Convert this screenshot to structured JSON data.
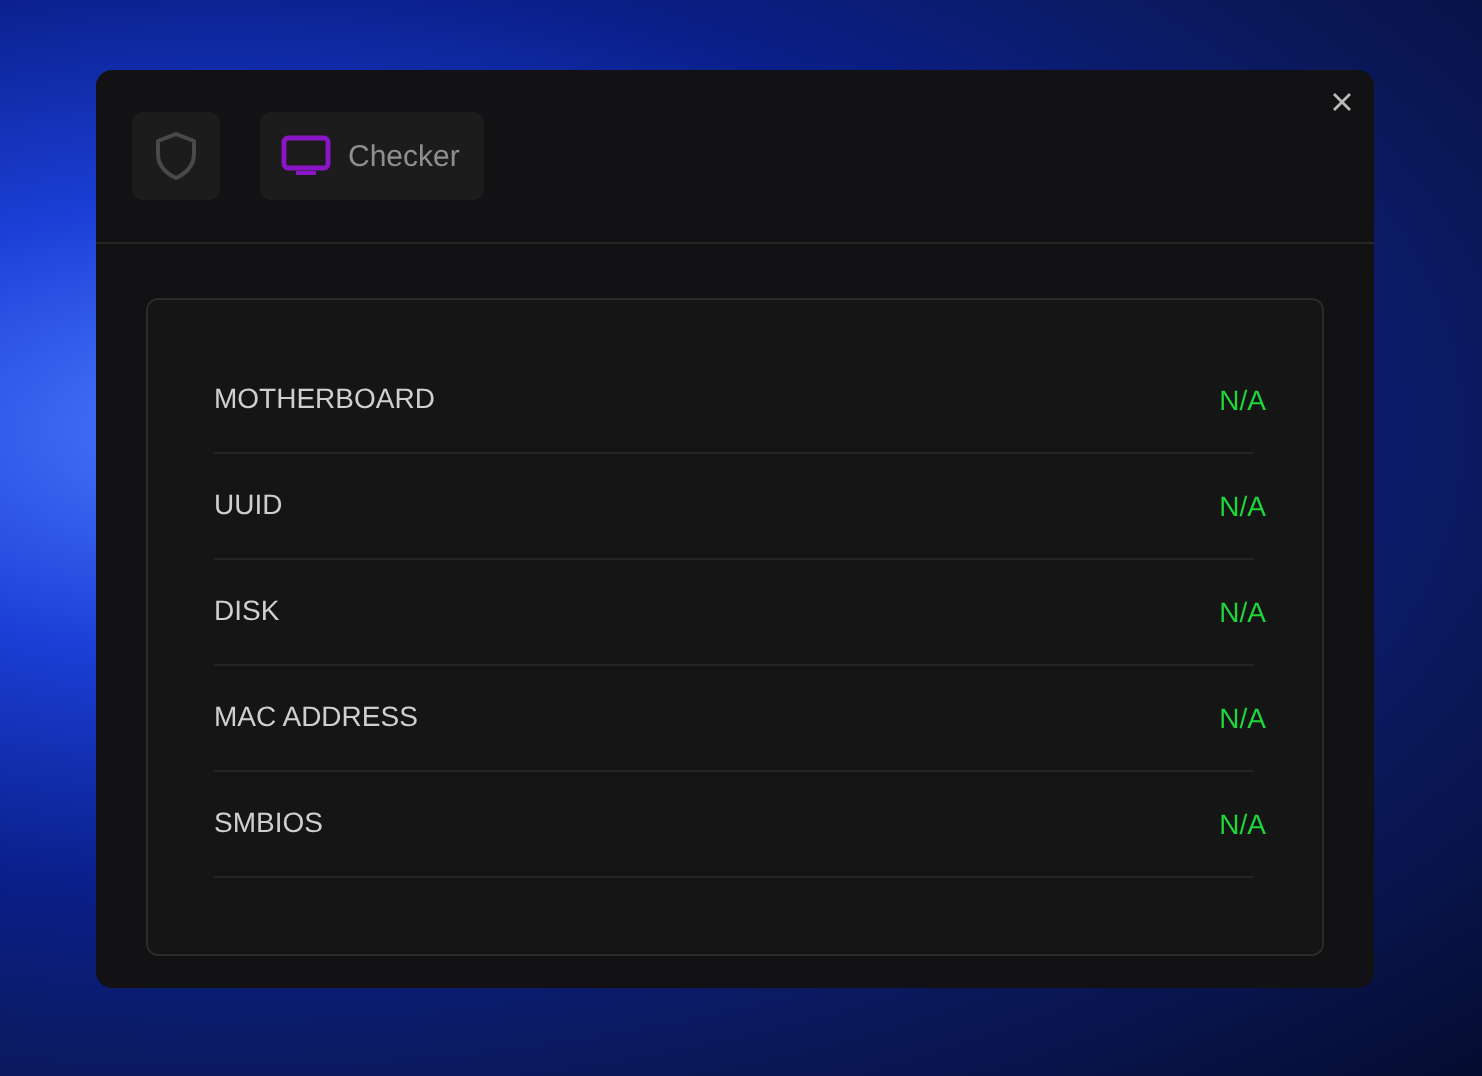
{
  "tabs": [
    {
      "kind": "shield",
      "selected": false
    },
    {
      "kind": "monitor",
      "label": "Checker",
      "selected": true
    }
  ],
  "rows": [
    {
      "label": "MOTHERBOARD",
      "value": "N/A"
    },
    {
      "label": "UUID",
      "value": "N/A"
    },
    {
      "label": "DISK",
      "value": "N/A"
    },
    {
      "label": "MAC ADDRESS",
      "value": "N/A"
    },
    {
      "label": "SMBIOS",
      "value": "N/A"
    }
  ]
}
